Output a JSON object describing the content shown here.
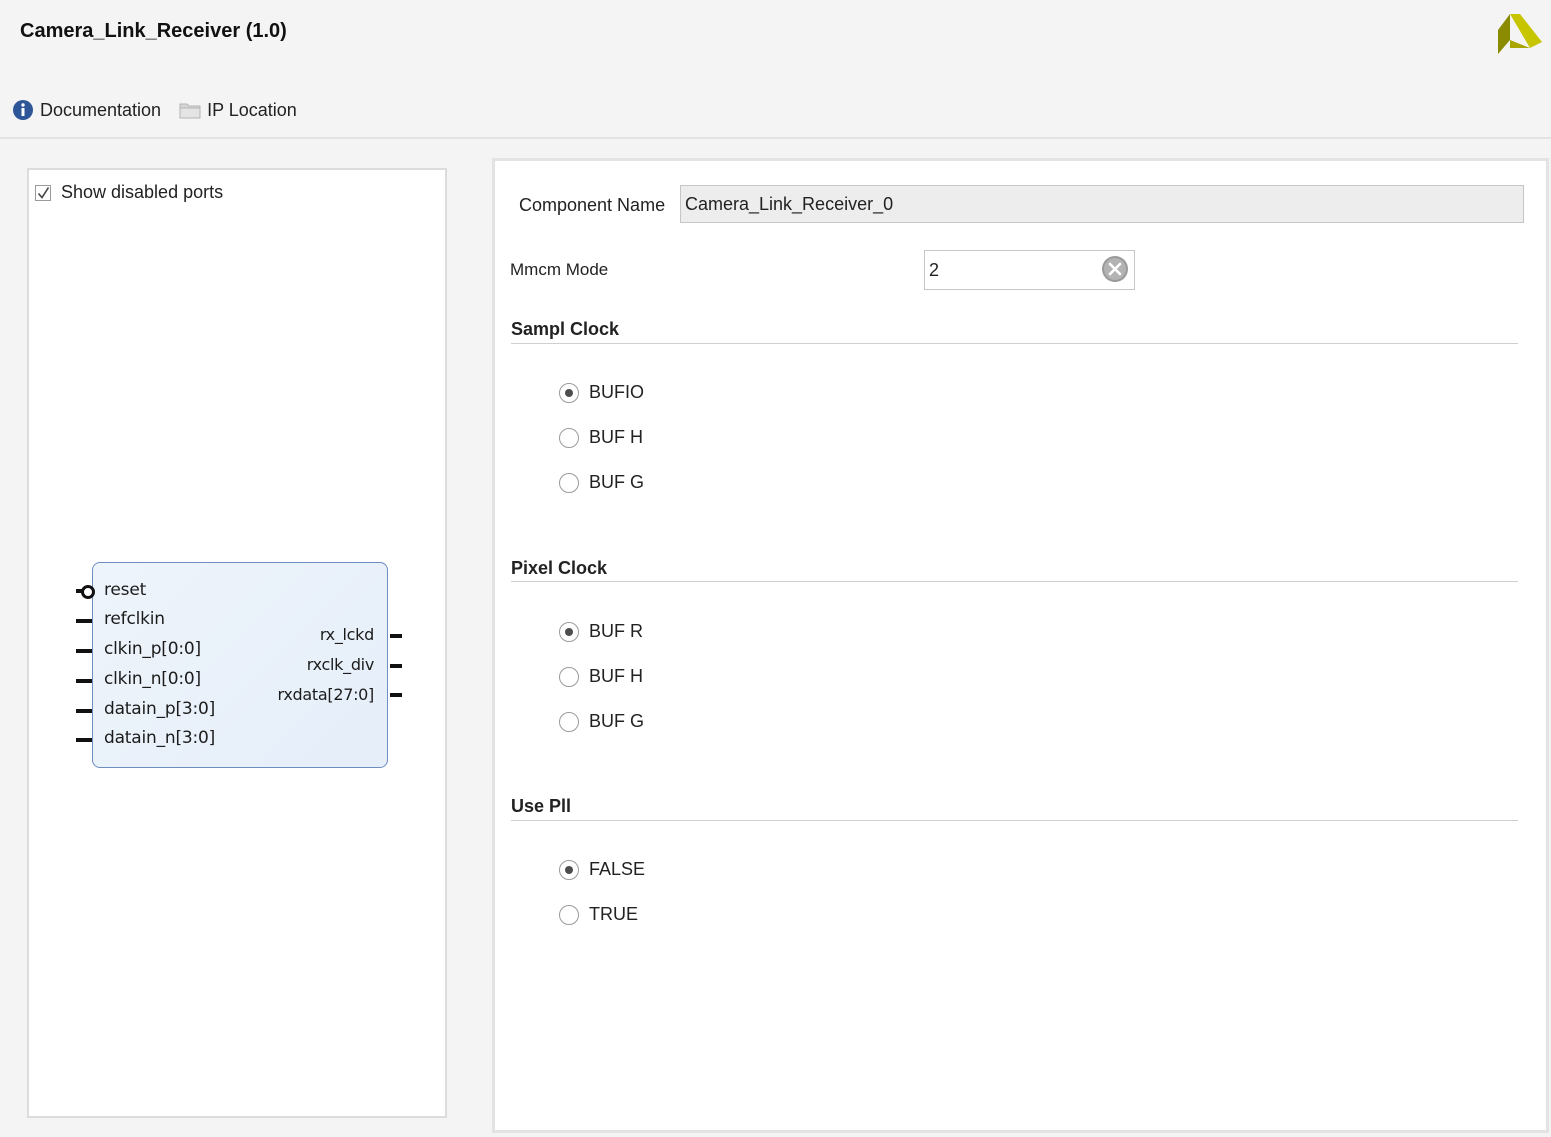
{
  "header": {
    "title": "Camera_Link_Receiver (1.0)",
    "logo_icon": "xilinx-logo-icon"
  },
  "toolbar": {
    "documentation_label": "Documentation",
    "documentation_icon": "info-icon",
    "ip_location_label": "IP Location",
    "ip_location_icon": "folder-icon"
  },
  "symbol_panel": {
    "show_disabled_ports_label": "Show disabled ports",
    "show_disabled_ports_checked": true,
    "inputs": [
      "reset",
      "refclkin",
      "clkin_p[0:0]",
      "clkin_n[0:0]",
      "datain_p[3:0]",
      "datain_n[3:0]"
    ],
    "outputs": [
      "rx_lckd",
      "rxclk_div",
      "rxdata[27:0]"
    ]
  },
  "config": {
    "component_name_label": "Component Name",
    "component_name_value": "Camera_Link_Receiver_0",
    "mmcm_mode_label": "Mmcm Mode",
    "mmcm_mode_value": "2",
    "sections": [
      {
        "title": "Sampl Clock",
        "options": [
          {
            "label": "BUFIO",
            "selected": true
          },
          {
            "label": "BUF H",
            "selected": false
          },
          {
            "label": "BUF G",
            "selected": false
          }
        ]
      },
      {
        "title": "Pixel Clock",
        "options": [
          {
            "label": "BUF R",
            "selected": true
          },
          {
            "label": "BUF H",
            "selected": false
          },
          {
            "label": "BUF G",
            "selected": false
          }
        ]
      },
      {
        "title": "Use Pll",
        "options": [
          {
            "label": "FALSE",
            "selected": true
          },
          {
            "label": "TRUE",
            "selected": false
          }
        ]
      }
    ]
  },
  "colors": {
    "block_border": "#6d8cc0",
    "block_fill": "#e9f1fa",
    "info_icon": "#2e5597",
    "logo_gold": "#b0a000"
  }
}
